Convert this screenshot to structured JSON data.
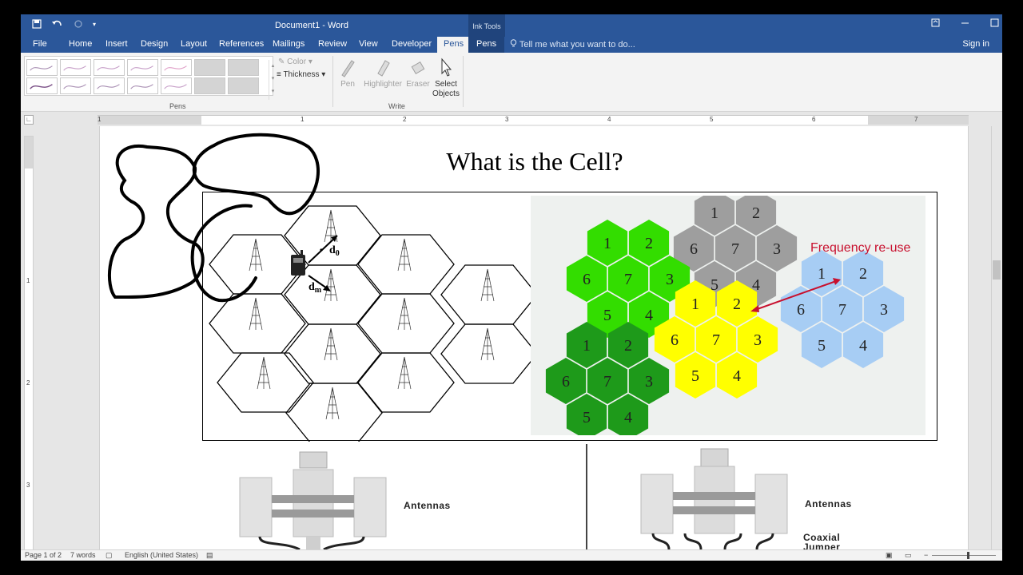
{
  "window": {
    "title": "Document1 - Word",
    "context_tab_group": "Ink Tools"
  },
  "qat": {
    "save_icon": "save-icon",
    "undo_icon": "undo-icon",
    "redo_icon": "redo-icon",
    "customize_icon": "chevron-down-icon"
  },
  "window_controls": {
    "ribbon_display_icon": "ribbon-display-icon",
    "minimize_icon": "minimize-icon",
    "maximize_icon": "maximize-icon"
  },
  "tabs": [
    "File",
    "Home",
    "Insert",
    "Design",
    "Layout",
    "References",
    "Mailings",
    "Review",
    "View",
    "Developer",
    "Pens"
  ],
  "active_tab": "Pens",
  "ink_tab": "Pens",
  "tell_me": {
    "placeholder": "Tell me what you want to do..."
  },
  "sign_in": "Sign in",
  "ribbon": {
    "pens_group": "Pens",
    "write_group": "Write",
    "color_label": "Color",
    "thickness_label": "Thickness",
    "pen_label": "Pen",
    "highlighter_label": "Highlighter",
    "eraser_label": "Eraser",
    "select_label_1": "Select",
    "select_label_2": "Objects"
  },
  "ruler": {
    "numbers": [
      "1",
      "1",
      "2",
      "3",
      "4",
      "5",
      "6",
      "7"
    ],
    "vnumbers": [
      "1",
      "2",
      "3"
    ]
  },
  "document": {
    "heading": "What is the Cell?",
    "labels": {
      "d0": "d",
      "d0_sub": "0",
      "dm": "d",
      "dm_sub": "m"
    },
    "frequency_reuse": "Frequency re-use",
    "antennas_label": "Antennas",
    "coaxial_label_1": "Coaxial",
    "coaxial_label_2": "Jumper",
    "reuse_cells": {
      "gray": [
        "1",
        "2",
        "6",
        "7",
        "3",
        "5",
        "4"
      ],
      "lightgreen": [
        "1",
        "2",
        "6",
        "7",
        "3",
        "5",
        "4"
      ],
      "blue": [
        "1",
        "2",
        "6",
        "7",
        "3",
        "5",
        "4"
      ],
      "yellow": [
        "1",
        "2",
        "6",
        "7",
        "3",
        "5",
        "4"
      ],
      "darkgreen": [
        "1",
        "2",
        "6",
        "7",
        "3",
        "5",
        "4"
      ]
    },
    "colors": {
      "gray": "#9e9e9e",
      "lightgreen": "#33dd00",
      "blue": "#a7cdf4",
      "yellow": "#ffff00",
      "darkgreen": "#1e9a1a"
    }
  },
  "status": {
    "page": "Page 1 of 2",
    "words": "7 words",
    "language": "English (United States)"
  }
}
